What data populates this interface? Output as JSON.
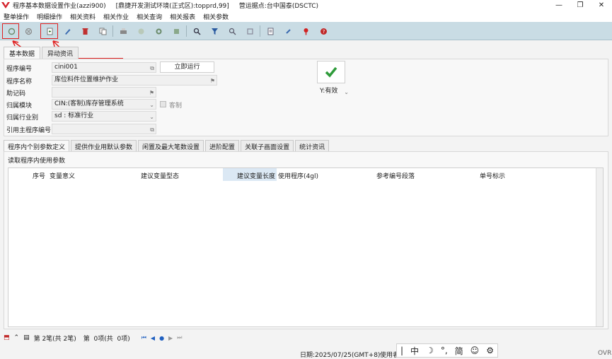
{
  "window": {
    "title": "程序基本数据设置作业(azzi900)",
    "env": "[鼎捷开发测试环境(正式区):topprd,99]",
    "site": "营运据点:台中国泰(DSCTC)"
  },
  "menu": [
    "整单操作",
    "明细操作",
    "相关资料",
    "相关作业",
    "相关查询",
    "相关报表",
    "相关参数"
  ],
  "colors": {
    "toolbar_bg": "#c9dce4",
    "highlight": "#e02020",
    "check_green": "#2e9b3a"
  },
  "tabs_top": [
    "基本数据",
    "异动资讯"
  ],
  "form": {
    "prog_no_label": "程序编号",
    "prog_no_value": "cini001",
    "run_button": "立即运行",
    "prog_name_label": "程序名称",
    "prog_name_value": "库位料件位置维护作业",
    "memo_label": "助记码",
    "module_label": "归属模块",
    "module_value": "CIN:(客制)库存管理系统",
    "custom_label": "客制",
    "industry_label": "归属行业别",
    "industry_value": "sd : 标准行业",
    "main_prog_label": "引用主程序编号",
    "status_value": "Y:有效"
  },
  "tabs_bottom": [
    "程序内个别参数定义",
    "提供作业用默认参数",
    "闲置及最大笔数设置",
    "进阶配置",
    "关联子画面设置",
    "统计资讯"
  ],
  "sub": {
    "title": "读取程序内使用参数",
    "columns": [
      "序号",
      "变量意义",
      "建议变量型态",
      "建议变量长度",
      "使用程序(4gl)",
      "参考编号段落",
      "单号标示"
    ]
  },
  "nav": {
    "record": "第 2笔(共 2笔)",
    "item": "第  0项(共  0项)"
  },
  "status": {
    "date": "日期:2025/07/25(GMT+8)",
    "user": "使用者",
    "ovr": "OVR"
  },
  "ime": [
    "中",
    "简"
  ]
}
